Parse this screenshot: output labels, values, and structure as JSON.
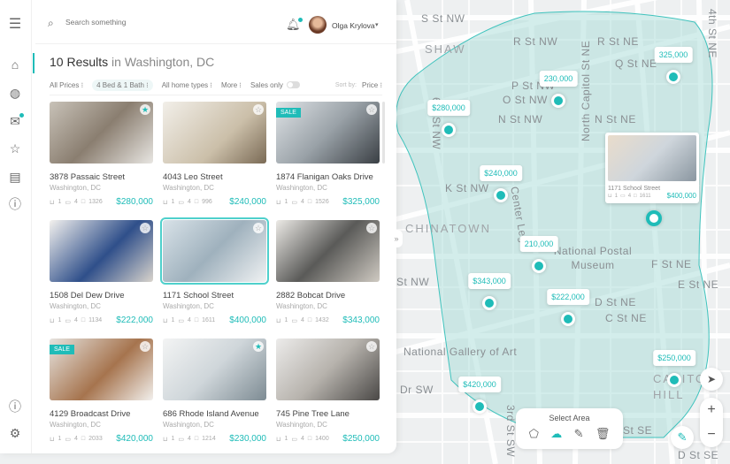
{
  "header": {
    "search_placeholder": "Search something",
    "user_name": "Olga Krylova",
    "user_caret": "▾"
  },
  "sidebar": {
    "items": [
      "menu",
      "home",
      "globe",
      "mail",
      "star",
      "listings",
      "help"
    ],
    "bottom": [
      "info",
      "settings"
    ]
  },
  "results": {
    "count": "10 Results",
    "location": " in Washington, DC"
  },
  "filters": {
    "prices": "All Prices ⁝",
    "beds": "4 Bed & 1 Bath ⁝",
    "home_types": "All home types ⁝",
    "more": "More ⁝",
    "sales_only": "Sales only",
    "sales_only_on": false,
    "sort_label": "Sort by:",
    "sort_value": "Price ⁝"
  },
  "listings": [
    {
      "name": "3878 Passaic Street",
      "city": "Washington, DC",
      "baths": "1",
      "beds": "4",
      "sqft": "1326",
      "price": "$280,000",
      "sale": false,
      "starred": true
    },
    {
      "name": "4043 Leo Street",
      "city": "Washington, DC",
      "baths": "1",
      "beds": "4",
      "sqft": "996",
      "price": "$240,000",
      "sale": false,
      "starred": false
    },
    {
      "name": "1874 Flanigan Oaks Drive",
      "city": "Washington, DC",
      "baths": "1",
      "beds": "4",
      "sqft": "1526",
      "price": "$325,000",
      "sale": true,
      "starred": false
    },
    {
      "name": "1508 Del Dew Drive",
      "city": "Washington, DC",
      "baths": "1",
      "beds": "4",
      "sqft": "1134",
      "price": "$222,000",
      "sale": false,
      "starred": false
    },
    {
      "name": "1171 School Street",
      "city": "Washington, DC",
      "baths": "1",
      "beds": "4",
      "sqft": "1611",
      "price": "$400,000",
      "sale": false,
      "starred": false,
      "selected": true
    },
    {
      "name": "2882 Bobcat Drive",
      "city": "Washington, DC",
      "baths": "1",
      "beds": "4",
      "sqft": "1432",
      "price": "$343,000",
      "sale": false,
      "starred": false
    },
    {
      "name": "4129 Broadcast Drive",
      "city": "Washington, DC",
      "baths": "1",
      "beds": "4",
      "sqft": "2033",
      "price": "$420,000",
      "sale": true,
      "starred": false
    },
    {
      "name": "686 Rhode Island Avenue",
      "city": "Washington, DC",
      "baths": "1",
      "beds": "4",
      "sqft": "1214",
      "price": "$230,000",
      "sale": false,
      "starred": true
    },
    {
      "name": "745 Pine Tree Lane",
      "city": "Washington, DC",
      "baths": "1",
      "beds": "4",
      "sqft": "1400",
      "price": "$250,000",
      "sale": false,
      "starred": false
    }
  ],
  "map": {
    "streets": [
      "S St NW",
      "SHAW",
      "R St NW",
      "R St NE",
      "Q St NE",
      "6th St NW",
      "P St NW",
      "O St NW",
      "N St NW",
      "N St NE",
      "North Capitol St NE",
      "K St NW",
      "Center Leg",
      "CHINATOWN",
      "National Postal Museum",
      "F St NE",
      "E St NE",
      "D St NE",
      "C St NE",
      "St NW",
      "National Gallery of Art",
      "Dr SW",
      "3rd St SW",
      "CAPITOL HILL",
      "St SE",
      "D St SE",
      "4th St NE"
    ],
    "pins": [
      "$280,000",
      "230,000",
      "325,000",
      "$240,000",
      "210,000",
      "$343,000",
      "$222,000",
      "$420,000",
      "$250,000"
    ],
    "popup": {
      "name": "1171 School Street",
      "baths": "1",
      "beds": "4",
      "sqft": "1611",
      "price": "$400,000"
    },
    "select_area": {
      "title": "Select Area",
      "tools": [
        "polygon",
        "freehand",
        "pencil",
        "trash"
      ],
      "active": "freehand"
    },
    "controls": {
      "zoom_in": "+",
      "zoom_out": "−"
    }
  },
  "colors": {
    "accent": "#1fbcb8",
    "area_fill": "#c9e8e6"
  }
}
